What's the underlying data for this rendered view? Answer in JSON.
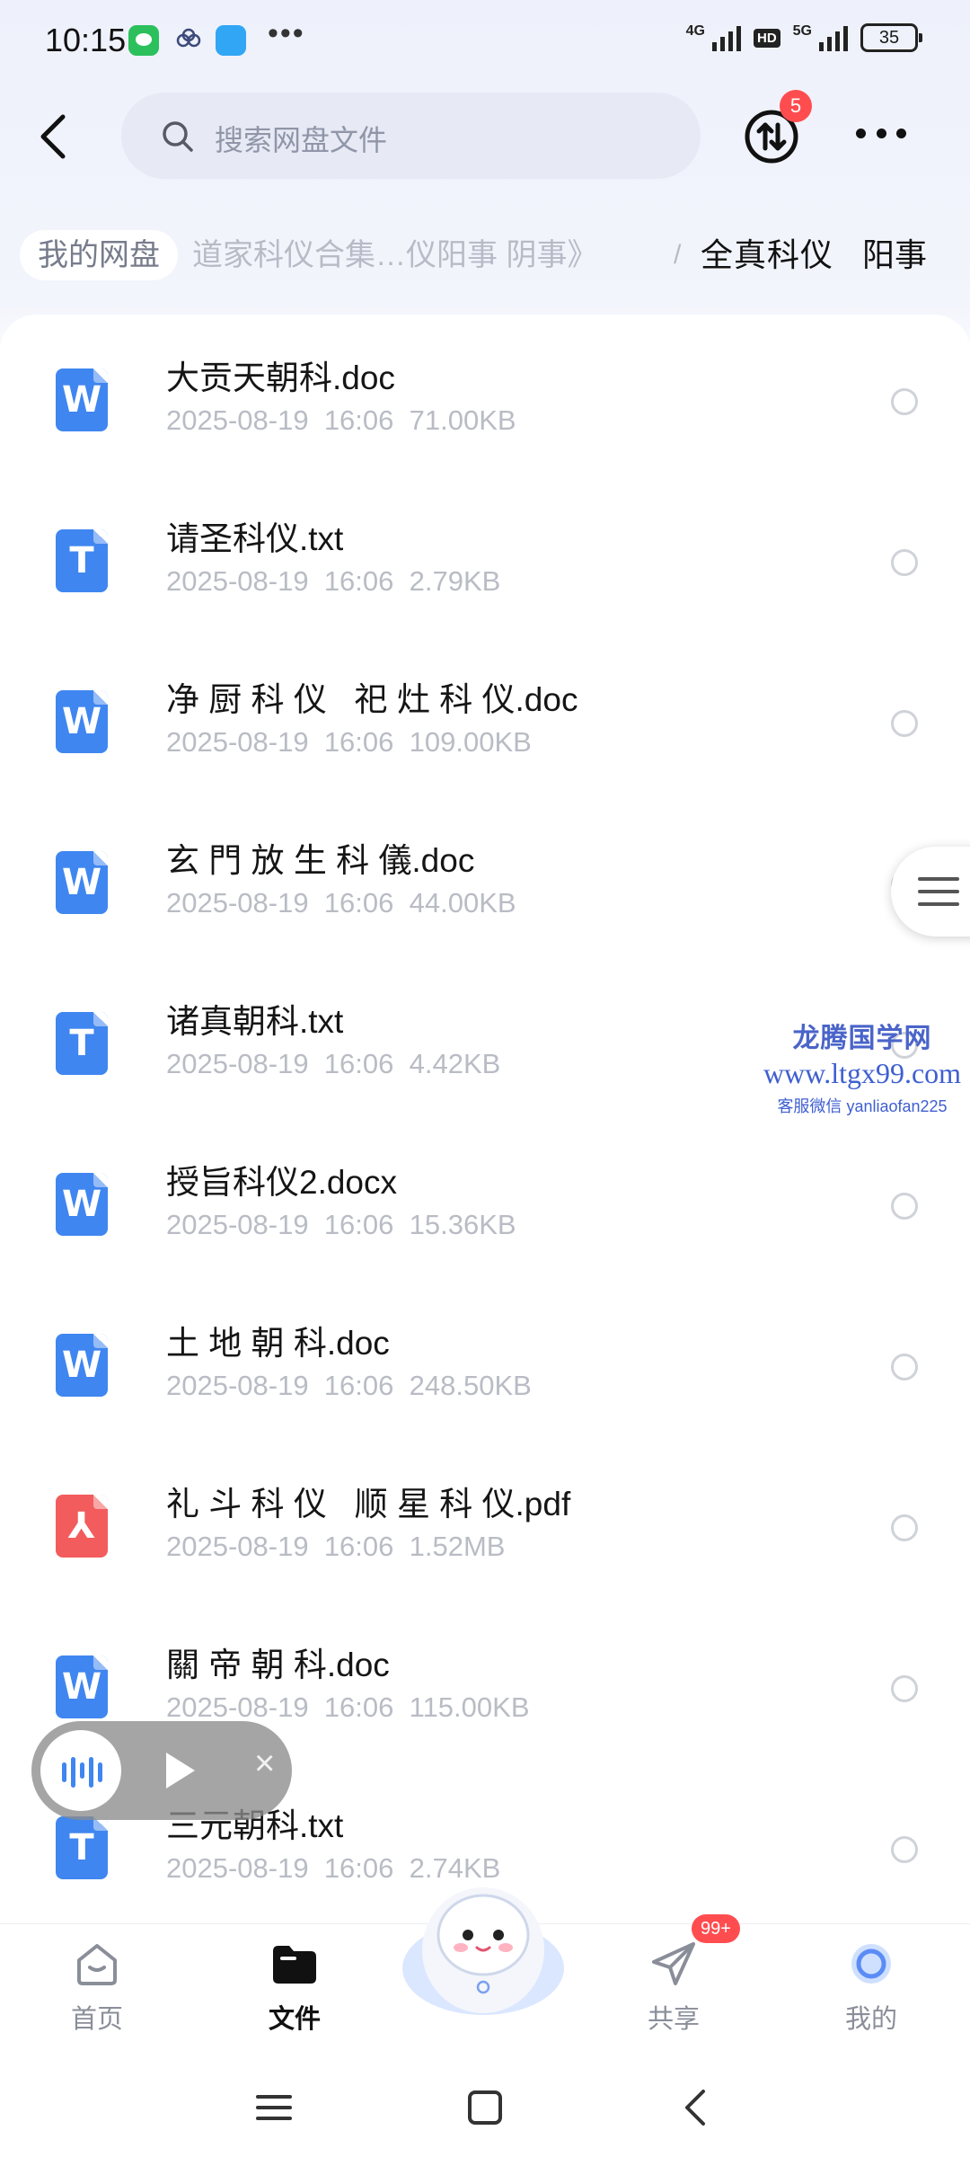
{
  "status_bar": {
    "time": "10:15",
    "network_4g": "4G",
    "network_5g": "5G",
    "hd": "HD",
    "battery": "35"
  },
  "top_bar": {
    "search_placeholder": "搜索网盘文件",
    "transfer_badge": "5"
  },
  "breadcrumb": {
    "root": "我的网盘",
    "middle": "道家科仪合集…仪阳事 阴事》",
    "separator": "/",
    "current": "全真科仪",
    "next": "阳事"
  },
  "files": [
    {
      "name": "大贡天朝科.doc",
      "date": "2025-08-19",
      "time": "16:06",
      "size": "71.00KB",
      "type": "word",
      "icon_glyph": "W"
    },
    {
      "name": "请圣科仪.txt",
      "date": "2025-08-19",
      "time": "16:06",
      "size": "2.79KB",
      "type": "txt",
      "icon_glyph": "T"
    },
    {
      "name": "净 厨 科 仪   祀 灶 科 仪.doc",
      "date": "2025-08-19",
      "time": "16:06",
      "size": "109.00KB",
      "type": "word",
      "icon_glyph": "W"
    },
    {
      "name": "玄 門 放 生 科 儀.doc",
      "date": "2025-08-19",
      "time": "16:06",
      "size": "44.00KB",
      "type": "word",
      "icon_glyph": "W"
    },
    {
      "name": "诸真朝科.txt",
      "date": "2025-08-19",
      "time": "16:06",
      "size": "4.42KB",
      "type": "txt",
      "icon_glyph": "T"
    },
    {
      "name": "授旨科仪2.docx",
      "date": "2025-08-19",
      "time": "16:06",
      "size": "15.36KB",
      "type": "word",
      "icon_glyph": "W"
    },
    {
      "name": "土 地 朝 科.doc",
      "date": "2025-08-19",
      "time": "16:06",
      "size": "248.50KB",
      "type": "word",
      "icon_glyph": "W"
    },
    {
      "name": "礼 斗 科 仪   顺 星 科 仪.pdf",
      "date": "2025-08-19",
      "time": "16:06",
      "size": "1.52MB",
      "type": "pdf",
      "icon_glyph": "⅄"
    },
    {
      "name": "關 帝 朝 科.doc",
      "date": "2025-08-19",
      "time": "16:06",
      "size": "115.00KB",
      "type": "word",
      "icon_glyph": "W"
    },
    {
      "name": "三元朝科.txt",
      "date": "2025-08-19",
      "time": "16:06",
      "size": "2.74KB",
      "type": "txt",
      "icon_glyph": "T"
    }
  ],
  "watermark": {
    "title": "龙腾国学网",
    "url": "www.ltgx99.com",
    "contact": "客服微信 yanliaofan225"
  },
  "audio_player": {
    "close_glyph": "×"
  },
  "bottom_nav": {
    "items": [
      {
        "label": "首页",
        "icon": "home-icon"
      },
      {
        "label": "文件",
        "icon": "folder-icon",
        "active": true
      },
      {
        "label": "共享",
        "icon": "send-icon"
      },
      {
        "label": "我的",
        "icon": "profile-icon"
      }
    ],
    "share_badge": "99+"
  },
  "colors": {
    "accent": "#3f86f0",
    "pdf": "#f25c5c",
    "badge": "#ff4d4f",
    "watermark": "#3f5fd0"
  }
}
